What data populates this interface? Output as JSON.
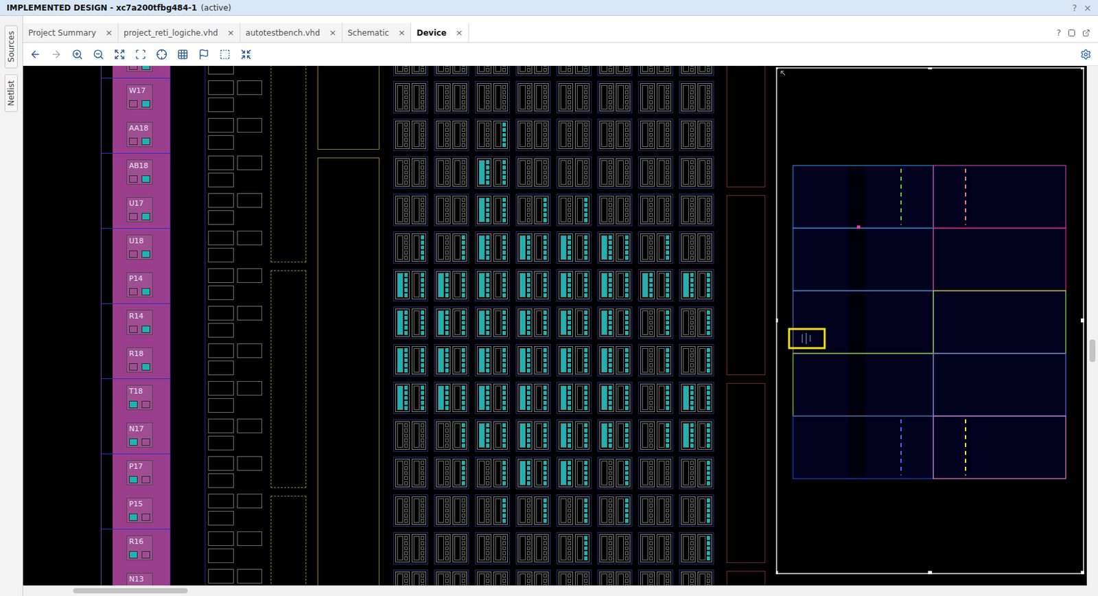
{
  "window": {
    "title": "IMPLEMENTED DESIGN - xc7a200tfbg484-1",
    "status": "(active)",
    "help": "?",
    "close": "×"
  },
  "side_tabs": [
    {
      "label": "Sources",
      "selected": false
    },
    {
      "label": "Netlist",
      "selected": false
    }
  ],
  "tabs": [
    {
      "label": "Project Summary",
      "selected": false,
      "close": "×"
    },
    {
      "label": "project_reti_logiche.vhd",
      "selected": false,
      "close": "×"
    },
    {
      "label": "autotestbench.vhd",
      "selected": false,
      "close": "×"
    },
    {
      "label": "Schematic",
      "selected": false,
      "close": "×"
    },
    {
      "label": "Device",
      "selected": true,
      "close": "×"
    }
  ],
  "tab_bar_help": "?",
  "pads": [
    {
      "label": "",
      "used": false
    },
    {
      "label": "W17",
      "used": false
    },
    {
      "label": "AA18",
      "used": false
    },
    {
      "label": "AB18",
      "used": false
    },
    {
      "label": "U17",
      "used": false
    },
    {
      "label": "U18",
      "used": false
    },
    {
      "label": "P14",
      "used": false
    },
    {
      "label": "R14",
      "used": false
    },
    {
      "label": "R18",
      "used": false
    },
    {
      "label": "T18",
      "used": true
    },
    {
      "label": "N17",
      "used": true
    },
    {
      "label": "P17",
      "used": true
    },
    {
      "label": "P15",
      "used": true
    },
    {
      "label": "R16",
      "used": true
    },
    {
      "label": "N13",
      "used": false
    }
  ],
  "clb_rows": [
    [
      0,
      0,
      0,
      0,
      0,
      0,
      0,
      0
    ],
    [
      0,
      0,
      0,
      0,
      0,
      0,
      0,
      0
    ],
    [
      0,
      0,
      1,
      0,
      0,
      0,
      0,
      0
    ],
    [
      0,
      0,
      2,
      0,
      0,
      0,
      0,
      0
    ],
    [
      0,
      0,
      2,
      1,
      1,
      0,
      0,
      0
    ],
    [
      1,
      1,
      2,
      2,
      2,
      2,
      1,
      0
    ],
    [
      2,
      2,
      2,
      2,
      2,
      2,
      2,
      2
    ],
    [
      2,
      2,
      2,
      2,
      2,
      2,
      1,
      1
    ],
    [
      2,
      2,
      2,
      2,
      2,
      2,
      1,
      1
    ],
    [
      2,
      2,
      2,
      2,
      2,
      2,
      1,
      2
    ],
    [
      0,
      1,
      2,
      2,
      2,
      2,
      1,
      2
    ],
    [
      0,
      1,
      1,
      2,
      2,
      1,
      0,
      1
    ],
    [
      0,
      0,
      1,
      1,
      1,
      1,
      0,
      1
    ],
    [
      0,
      0,
      0,
      0,
      1,
      0,
      0,
      1
    ],
    [
      0,
      0,
      0,
      0,
      0,
      0,
      0,
      0
    ]
  ]
}
